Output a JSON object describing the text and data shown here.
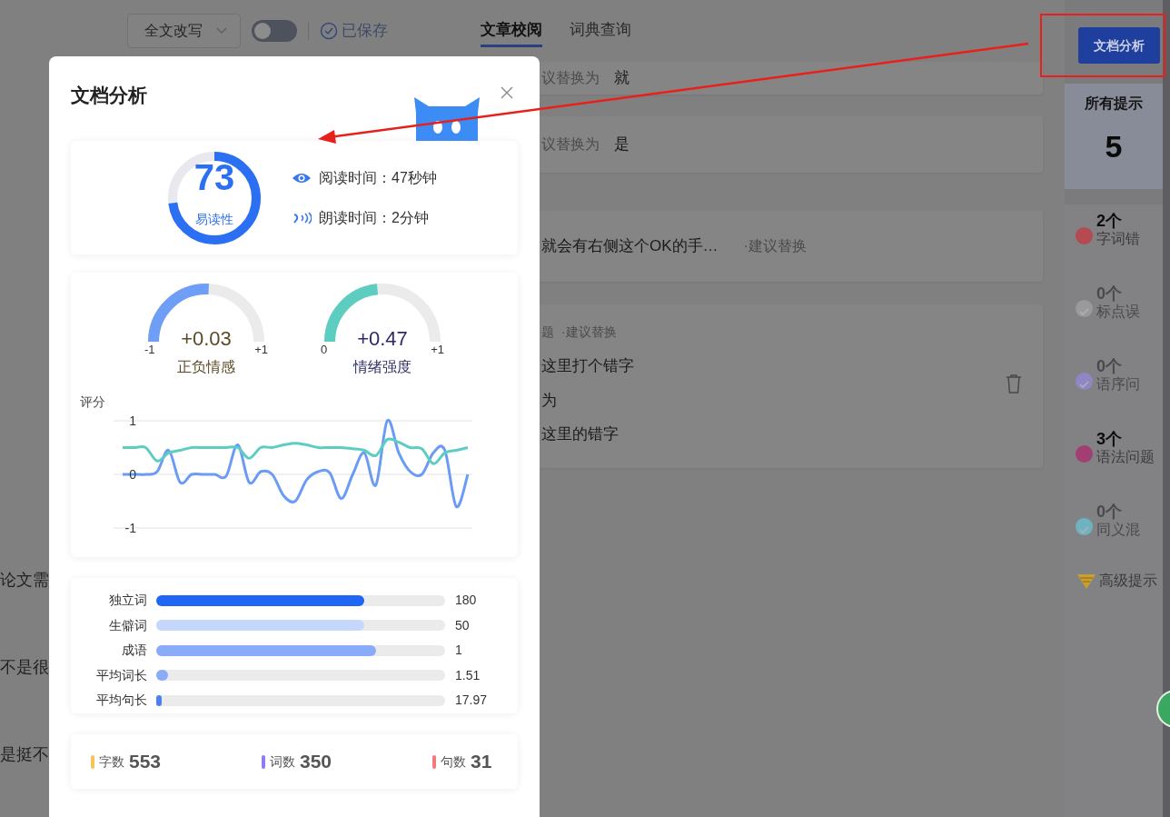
{
  "header": {
    "mode_select": {
      "value": "全文改写"
    },
    "toggle": {
      "on": false
    },
    "save_status": "已保存",
    "tabs": [
      {
        "label": "文章校阅",
        "selected": true
      },
      {
        "label": "词典查询",
        "selected": false
      }
    ]
  },
  "editor": {
    "lines": [
      "论文需",
      "不是很",
      "是挺不"
    ]
  },
  "suggestions": [
    {
      "kind": "replace",
      "hint": "议替换为",
      "replacement": "就"
    },
    {
      "kind": "replace",
      "hint": "议替换为",
      "replacement": "是"
    },
    {
      "kind": "inline",
      "text": "就会有右侧这个OK的手…",
      "hint": "·建议替换"
    },
    {
      "kind": "detail",
      "category": "题",
      "hint": "·建议替换",
      "original": "这里打个错字",
      "action": "为",
      "corrected": "这里的错字"
    }
  ],
  "sidebar": {
    "action_button": "文档分析",
    "title": "所有提示",
    "total": "5",
    "categories": [
      {
        "count": "2个",
        "label": "字词错",
        "color": "#b54a50",
        "disabled": false
      },
      {
        "count": "0个",
        "label": "标点误",
        "color": "#9a9a9a",
        "disabled": true
      },
      {
        "count": "0个",
        "label": "语序问",
        "color": "#8f86c4",
        "disabled": true
      },
      {
        "count": "3个",
        "label": "语法问题",
        "color": "#a13f72",
        "disabled": false
      },
      {
        "count": "0个",
        "label": "同义混",
        "color": "#6fb3c0",
        "disabled": true
      }
    ],
    "premium": "高级提示"
  },
  "modal": {
    "title": "文档分析",
    "readability": {
      "score": "73",
      "label": "易读性",
      "level": 0.73
    },
    "times": [
      {
        "kind": "read",
        "text": "阅读时间：47秒钟"
      },
      {
        "kind": "speak",
        "text": "朗读时间：2分钟"
      }
    ],
    "gauges": [
      {
        "value": "+0.03",
        "label": "正负情感",
        "min": "-1",
        "max": "+1",
        "level": 0.515,
        "color": "#6f9ef7"
      },
      {
        "value": "+0.47",
        "label": "情绪强度",
        "min": "0",
        "max": "+1",
        "level": 0.47,
        "color": "#5ccdc0"
      }
    ],
    "chart_data": {
      "type": "line",
      "ylabel": "评分",
      "ylim": [
        -1,
        1
      ],
      "yticks": [
        1,
        0,
        -1
      ],
      "series": [
        {
          "color": "#6b9cf5",
          "values": [
            0,
            0,
            0,
            0.05,
            0.45,
            -0.15,
            0,
            0,
            0,
            -0.03,
            0.55,
            -0.15,
            0.05,
            0,
            -0.4,
            -0.5,
            -0.1,
            0.05,
            0.03,
            -0.45,
            0,
            0.4,
            -0.2,
            1.0,
            0.4,
            0.05,
            0,
            0.4,
            0.45,
            -0.6,
            0
          ]
        },
        {
          "color": "#5ccdc0",
          "values": [
            0.5,
            0.5,
            0.5,
            0.25,
            0.4,
            0.45,
            0.5,
            0.5,
            0.5,
            0.5,
            0.5,
            0.3,
            0.5,
            0.5,
            0.55,
            0.58,
            0.55,
            0.5,
            0.5,
            0.5,
            0.48,
            0.45,
            0.35,
            0.65,
            0.6,
            0.5,
            0.48,
            0.2,
            0.4,
            0.45,
            0.5
          ]
        }
      ]
    },
    "bars": [
      {
        "label": "独立词",
        "value": "180",
        "level": 0.72,
        "color": "#1f66f4"
      },
      {
        "label": "生僻词",
        "value": "50",
        "level": 0.72,
        "color": "#c5d8fb"
      },
      {
        "label": "成语",
        "value": "1",
        "level": 0.76,
        "color": "#8aacf8"
      },
      {
        "label": "平均词长",
        "value": "1.51",
        "level": 0.04,
        "color": "#8aacf8"
      },
      {
        "label": "平均句长",
        "value": "17.97",
        "level": 0.02,
        "color": "#4a80f0"
      }
    ],
    "counts": [
      {
        "label": "字数",
        "value": "553",
        "color": "#f6c35a"
      },
      {
        "label": "词数",
        "value": "350",
        "color": "#8f7cf0"
      },
      {
        "label": "句数",
        "value": "31",
        "color": "#f27a7a"
      }
    ]
  }
}
